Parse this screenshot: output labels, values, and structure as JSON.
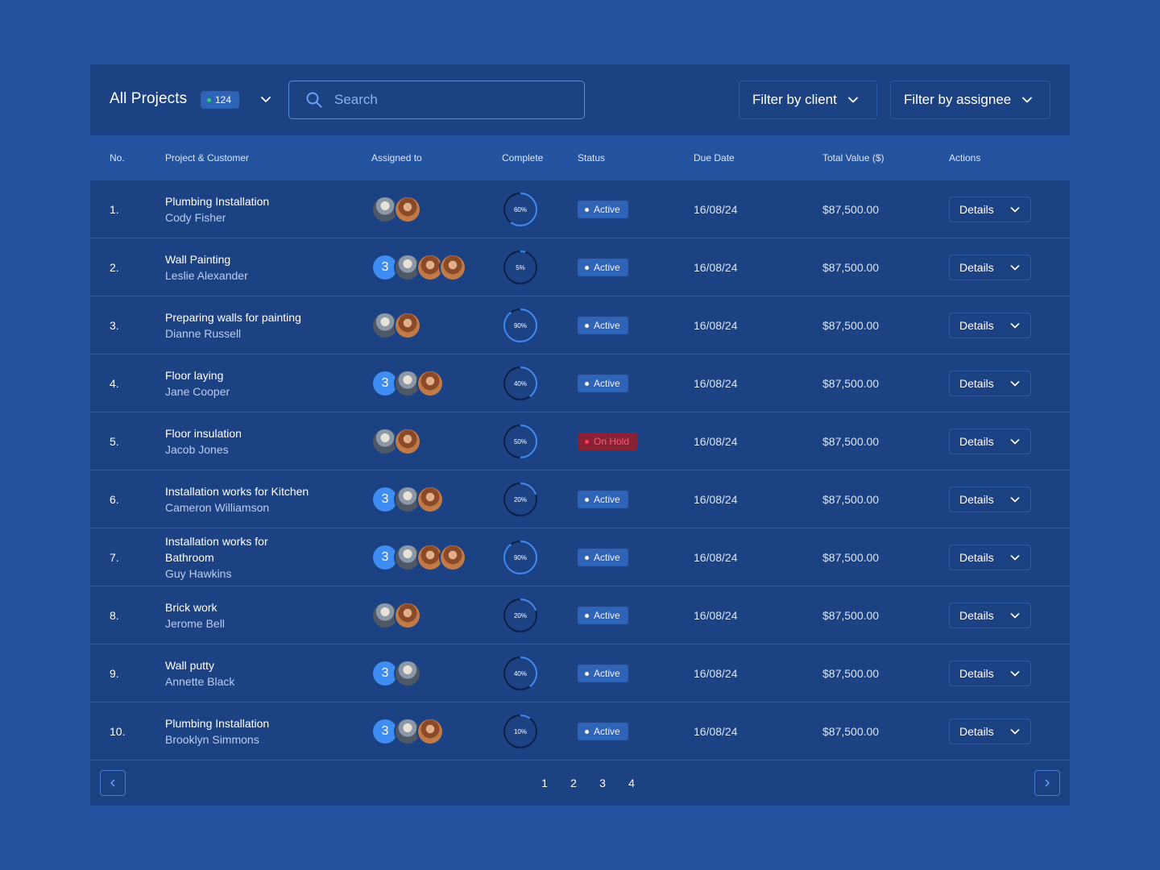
{
  "header": {
    "title": "All Projects",
    "count": "124",
    "search_placeholder": "Search",
    "filter_client": "Filter by client",
    "filter_assignee": "Filter by assignee"
  },
  "columns": {
    "no": "No.",
    "project": "Project & Customer",
    "assigned": "Assigned to",
    "complete": "Complete",
    "status": "Status",
    "due": "Due Date",
    "value": "Total Value ($)",
    "actions": "Actions"
  },
  "colors": {
    "background": "#2453a0",
    "panel": "#1d4283",
    "accent": "#3f8cf2",
    "active_badge": "#2f63b8",
    "onhold_text": "#ff5a6a"
  },
  "rows": [
    {
      "no": "1.",
      "project": "Plumbing Installation",
      "customer": "Cody Fisher",
      "avatars": [
        "p1",
        "p2"
      ],
      "extra": "",
      "complete": "60%",
      "progress": 60,
      "status": "Active",
      "status_kind": "active",
      "due": "16/08/24",
      "value": "$87,500.00",
      "action": "Details"
    },
    {
      "no": "2.",
      "project": "Wall Painting",
      "customer": "Leslie Alexander",
      "avatars": [
        "p1",
        "p2",
        "p2"
      ],
      "extra": "3",
      "complete": "5%",
      "progress": 5,
      "status": "Active",
      "status_kind": "active",
      "due": "16/08/24",
      "value": "$87,500.00",
      "action": "Details"
    },
    {
      "no": "3.",
      "project": "Preparing walls for painting",
      "customer": "Dianne Russell",
      "avatars": [
        "p1",
        "p2"
      ],
      "extra": "",
      "complete": "90%",
      "progress": 90,
      "status": "Active",
      "status_kind": "active",
      "due": "16/08/24",
      "value": "$87,500.00",
      "action": "Details"
    },
    {
      "no": "4.",
      "project": "Floor laying",
      "customer": "Jane Cooper",
      "avatars": [
        "p1",
        "p2"
      ],
      "extra": "3",
      "complete": "40%",
      "progress": 40,
      "status": "Active",
      "status_kind": "active",
      "due": "16/08/24",
      "value": "$87,500.00",
      "action": "Details"
    },
    {
      "no": "5.",
      "project": "Floor insulation",
      "customer": "Jacob Jones",
      "avatars": [
        "p1",
        "p2"
      ],
      "extra": "",
      "complete": "50%",
      "progress": 50,
      "status": "On Hold",
      "status_kind": "onhold",
      "due": "16/08/24",
      "value": "$87,500.00",
      "action": "Details"
    },
    {
      "no": "6.",
      "project": "Installation works for Kitchen",
      "customer": "Cameron Williamson",
      "avatars": [
        "p1",
        "p2"
      ],
      "extra": "3",
      "complete": "20%",
      "progress": 20,
      "status": "Active",
      "status_kind": "active",
      "due": "16/08/24",
      "value": "$87,500.00",
      "action": "Details"
    },
    {
      "no": "7.",
      "project": "Installation works for Bathroom",
      "customer": "Guy Hawkins",
      "avatars": [
        "p1",
        "p2",
        "p2"
      ],
      "extra": "3",
      "complete": "90%",
      "progress": 90,
      "status": "Active",
      "status_kind": "active",
      "due": "16/08/24",
      "value": "$87,500.00",
      "action": "Details"
    },
    {
      "no": "8.",
      "project": "Brick work",
      "customer": "Jerome Bell",
      "avatars": [
        "p1",
        "p2"
      ],
      "extra": "",
      "complete": "20%",
      "progress": 20,
      "status": "Active",
      "status_kind": "active",
      "due": "16/08/24",
      "value": "$87,500.00",
      "action": "Details"
    },
    {
      "no": "9.",
      "project": "Wall putty",
      "customer": "Annette Black",
      "avatars": [
        "p1"
      ],
      "extra": "3",
      "complete": "40%",
      "progress": 40,
      "status": "Active",
      "status_kind": "active",
      "due": "16/08/24",
      "value": "$87,500.00",
      "action": "Details"
    },
    {
      "no": "10.",
      "project": "Plumbing Installation",
      "customer": "Brooklyn Simmons",
      "avatars": [
        "p1",
        "p2"
      ],
      "extra": "3",
      "complete": "10%",
      "progress": 10,
      "status": "Active",
      "status_kind": "active",
      "due": "16/08/24",
      "value": "$87,500.00",
      "action": "Details"
    }
  ],
  "pagination": {
    "pages": [
      "1",
      "2",
      "3",
      "4"
    ]
  }
}
